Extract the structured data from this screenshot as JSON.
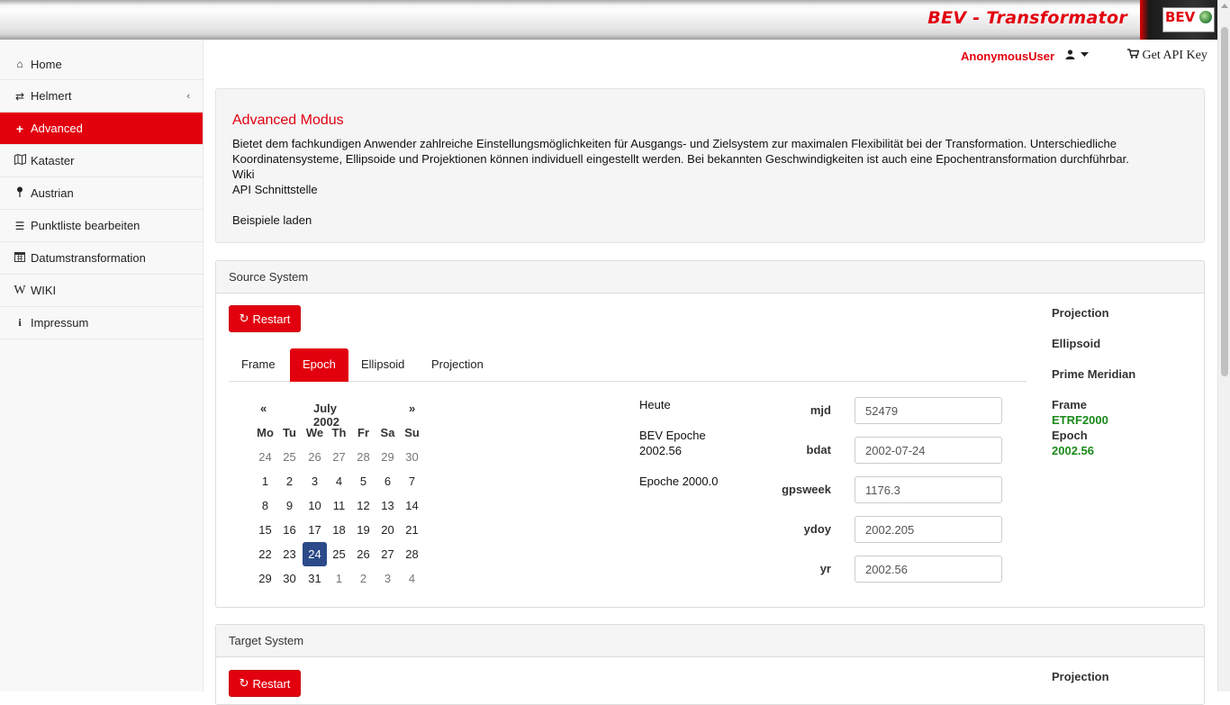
{
  "header": {
    "title": "BEV - Transformator",
    "logo_text": "BEV"
  },
  "topbar": {
    "user_name": "AnonymousUser",
    "api_key_label": "Get API Key"
  },
  "sidebar": {
    "items": [
      {
        "label": "Home",
        "icon": "home-icon"
      },
      {
        "label": "Helmert",
        "icon": "exchange-icon"
      },
      {
        "label": "Advanced",
        "icon": "plus-icon"
      },
      {
        "label": "Kataster",
        "icon": "map-icon"
      },
      {
        "label": "Austrian",
        "icon": "map-pin-icon"
      },
      {
        "label": "Punktliste bearbeiten",
        "icon": "list-icon"
      },
      {
        "label": "Datumstransformation",
        "icon": "calendar-icon"
      },
      {
        "label": "WIKI",
        "icon": "wikipedia-icon"
      },
      {
        "label": "Impressum",
        "icon": "info-icon"
      }
    ]
  },
  "intro": {
    "title": "Advanced Modus",
    "description": "Bietet dem fachkundigen Anwender zahlreiche Einstellungsmöglichkeiten für Ausgangs- und Zielsystem zur maximalen Flexibilität bei der Transformation. Unterschiedliche Koordinatensysteme, Ellipsoide und Projektionen können individuell eingestellt werden. Bei bekannten Geschwindigkeiten ist auch eine Epochentransformation durchführbar.",
    "wiki_link": "Wiki",
    "api_link": "API Schnittstelle",
    "examples_link": "Beispiele laden"
  },
  "source": {
    "heading": "Source System",
    "restart_label": "Restart",
    "tabs": [
      "Frame",
      "Epoch",
      "Ellipsoid",
      "Projection"
    ],
    "active_tab": "Epoch",
    "calendar": {
      "prev": "«",
      "next": "»",
      "month_label": "July 2002",
      "weekdays": [
        "Mo",
        "Tu",
        "We",
        "Th",
        "Fr",
        "Sa",
        "Su"
      ],
      "weeks": [
        [
          "24",
          "25",
          "26",
          "27",
          "28",
          "29",
          "30"
        ],
        [
          "1",
          "2",
          "3",
          "4",
          "5",
          "6",
          "7"
        ],
        [
          "8",
          "9",
          "10",
          "11",
          "12",
          "13",
          "14"
        ],
        [
          "15",
          "16",
          "17",
          "18",
          "19",
          "20",
          "21"
        ],
        [
          "22",
          "23",
          "24",
          "25",
          "26",
          "27",
          "28"
        ],
        [
          "29",
          "30",
          "31",
          "1",
          "2",
          "3",
          "4"
        ]
      ],
      "selected_day": "24"
    },
    "quick_links": {
      "today": "Heute",
      "bev_epoch_line1": "BEV Epoche",
      "bev_epoch_line2": "2002.56",
      "epoch_2000": "Epoche 2000.0"
    },
    "fields": [
      {
        "label": "mjd",
        "value": "52479"
      },
      {
        "label": "bdat",
        "value": "2002-07-24"
      },
      {
        "label": "gpsweek",
        "value": "1176.3"
      },
      {
        "label": "ydoy",
        "value": "2002.205"
      },
      {
        "label": "yr",
        "value": "2002.56"
      }
    ],
    "summary": {
      "projection_label": "Projection",
      "ellipsoid_label": "Ellipsoid",
      "prime_meridian_label": "Prime Meridian",
      "frame_label": "Frame",
      "frame_value": "ETRF2000",
      "epoch_label": "Epoch",
      "epoch_value": "2002.56"
    }
  },
  "target": {
    "heading": "Target System",
    "restart_label": "Restart",
    "projection_label": "Projection"
  },
  "colors": {
    "brand_red": "#e2000f",
    "selected_day": "#2c4a8a",
    "summary_green": "#1a8a1a"
  }
}
